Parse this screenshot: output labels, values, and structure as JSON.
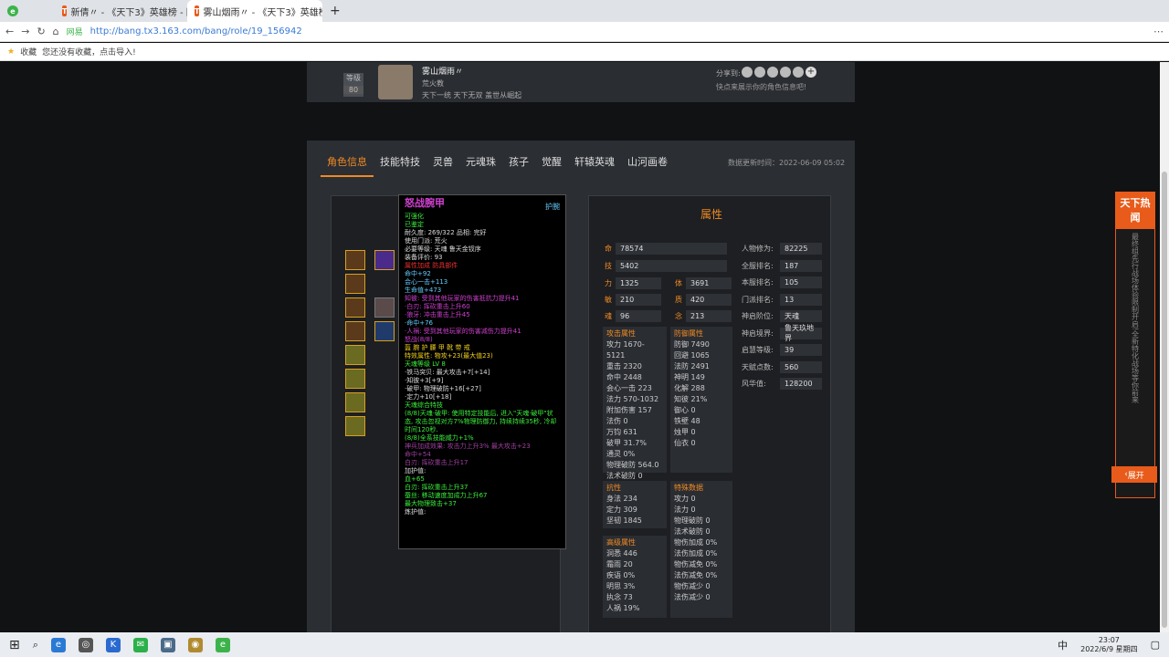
{
  "browser": {
    "tabs": [
      {
        "label": "新倩〃 - 《天下3》英雄榜 - 网易...",
        "active": false
      },
      {
        "label": "雾山烟雨〃 - 《天下3》英雄榜 - ...",
        "active": true
      }
    ],
    "new_tab": "+",
    "url": "http://bang.tx3.163.com/bang/role/19_156942",
    "secure_label": "网易",
    "bookmarks_label": "收藏",
    "bookmarks_hint": "您还没有收藏，点击导入!"
  },
  "profile": {
    "level_label": "等级",
    "level": "80",
    "name": "雾山烟雨〃",
    "school": "荒火教",
    "motto": "天下一统 天下无双 盖世从崛起",
    "share_label": "分享到:",
    "share_hint": "快点来展示你的角色信息吧!"
  },
  "nav": {
    "tabs": [
      "角色信息",
      "技能特技",
      "灵兽",
      "元魂珠",
      "孩子",
      "觉醒",
      "轩辕英魂",
      "山河画卷"
    ],
    "update": "数据更新时间：2022-06-09 05:02"
  },
  "tooltip": {
    "title": "怒战腕甲",
    "badge": "护腕",
    "lines": [
      {
        "t": "可强化",
        "c": "#3cf03c"
      },
      {
        "t": "已鉴定",
        "c": "#3cf03c"
      },
      {
        "t": "耐久度: 269/322    品相: 完好",
        "c": "#ddd"
      },
      {
        "t": "使用门派: 荒火",
        "c": "#ddd"
      },
      {
        "t": "必要等级: 天魂 鲁天金钗序",
        "c": "#ddd"
      },
      {
        "t": "装备评价: 93",
        "c": "#ddd"
      },
      {
        "t": "属性加成 防具部件",
        "c": "#f03030"
      },
      {
        "t": "命中+92",
        "c": "#6cf"
      },
      {
        "t": "会心一击+113",
        "c": "#6cf"
      },
      {
        "t": "生命值+473",
        "c": "#6cf"
      },
      {
        "t": "知彼: 受到其他玩家的伤害抵抗力提升41",
        "c": "#d040d0"
      },
      {
        "t": "·白刃: 挥砍重击上升60",
        "c": "#d040d0"
      },
      {
        "t": "·狼牙: 冲击重击上升45",
        "c": "#d040d0"
      },
      {
        "t": "·命中+76",
        "c": "#6cf"
      },
      {
        "t": "·人祸: 受到其他玩家的伤害减伤力提升41",
        "c": "#d040d0"
      },
      {
        "t": "怒战(8/8)",
        "c": "#d040d0"
      },
      {
        "t": "   盔 腕 护 腰 甲 靴 带 戒",
        "c": "#f0d020"
      },
      {
        "t": "   特效属性: 物攻+23(最大值23)",
        "c": "#f0d020"
      },
      {
        "t": "天魂等级 LV 8",
        "c": "#3cf03c"
      },
      {
        "t": "·铁马突贝: 最大攻击+7[+14]",
        "c": "#ddd"
      },
      {
        "t": "·知彼+3[+9]",
        "c": "#ddd"
      },
      {
        "t": "·破甲: 物理破防+16[+27]",
        "c": "#ddd"
      },
      {
        "t": "·定力+10[+18]",
        "c": "#ddd"
      },
      {
        "t": "天魂综合特技",
        "c": "#3cf03c"
      },
      {
        "t": "(8/8)天魂·破甲: 使用特定技能后, 进入\"天魂·破甲\"状态, 攻击忽视对方7%物理防御力, 持续持续35秒, 冷却时间120秒.",
        "c": "#3cf03c"
      },
      {
        "t": "(8/8)全系技能威力+1%",
        "c": "#3cf03c"
      },
      {
        "t": "神兵加成效果: 攻击力上升3% 最大攻击+23",
        "c": "#a040a0"
      },
      {
        "t": "命中+54",
        "c": "#a040a0"
      },
      {
        "t": "白刃: 挥砍重击上升17",
        "c": "#a040a0"
      },
      {
        "t": "加护值:",
        "c": "#ddd"
      },
      {
        "t": "血+65",
        "c": "#3cf03c"
      },
      {
        "t": "白刃: 挥砍重击上升37",
        "c": "#3cf03c"
      },
      {
        "t": "蚕丝: 移动速度加成力上升67",
        "c": "#3cf03c"
      },
      {
        "t": "最大物理致击+37",
        "c": "#3cf03c"
      },
      {
        "t": "炼护值:",
        "c": "#ddd"
      }
    ]
  },
  "attr": {
    "title": "属性",
    "hp_label": "命",
    "hp": "78574",
    "mp_label": "技",
    "mp": "5402",
    "str_label": "力",
    "str": "1325",
    "con_label": "体",
    "con": "3691",
    "agi_label": "敏",
    "agi": "210",
    "spi_label": "质",
    "spi": "420",
    "soul_label": "魂",
    "soul": "96",
    "int_label": "念",
    "int": "213",
    "right": [
      {
        "k": "人物修为:",
        "v": "82225"
      },
      {
        "k": "全服排名:",
        "v": "187"
      },
      {
        "k": "本服排名:",
        "v": "105"
      },
      {
        "k": "门派排名:",
        "v": "13"
      },
      {
        "k": "神启阶位:",
        "v": "天魂"
      },
      {
        "k": "神启境界:",
        "v": "鲁天玖地界"
      },
      {
        "k": "启慧等级:",
        "v": "39"
      },
      {
        "k": "天赋点数:",
        "v": "560"
      },
      {
        "k": "风华值:",
        "v": "128200"
      }
    ],
    "attack": {
      "title": "攻击属性",
      "rows": [
        "攻力 1670-5121",
        "重击 2320",
        "命中 2448",
        "会心一击 223",
        "法力 570-1032",
        "附加伤害 157",
        "法伤 0",
        "万钧 631",
        "破甲 31.7%",
        "通灵 0%",
        "物理破防 564.0",
        "法术破防 0"
      ]
    },
    "defense": {
      "title": "防御属性",
      "rows": [
        "防御 7490",
        "回避 1065",
        "法防 2491",
        "神明 149",
        "化解 288",
        "知彼 21%",
        "御心 0",
        "铁壁 48",
        "烛甲 0",
        "仙衣 0"
      ]
    },
    "resist": {
      "title": "抗性",
      "rows": [
        "身法 234",
        "定力 309",
        "坚韧 1845"
      ]
    },
    "advanced": {
      "title": "高级属性",
      "rows": [
        "洞悉 446",
        "霜雨 20",
        "疾语 0%",
        "明思 3%",
        "执念 73",
        "人祸 19%"
      ]
    },
    "special": {
      "title": "特殊数据",
      "rows": [
        "攻力 0",
        "法力 0",
        "物理破防 0",
        "法术破防 0",
        "物伤加成 0%",
        "法伤加成 0%",
        "物伤减免 0%",
        "法伤减免 0%",
        "物伤减少 0",
        "法伤减少 0"
      ]
    }
  },
  "sidebar": {
    "title": "天下热闻",
    "text": "最终组先行战场体验限制开启!全新特化战场等你前来",
    "expand": "展开"
  },
  "taskbar": {
    "time": "23:07",
    "date": "2022/6/9 星期四",
    "ime": "中"
  }
}
